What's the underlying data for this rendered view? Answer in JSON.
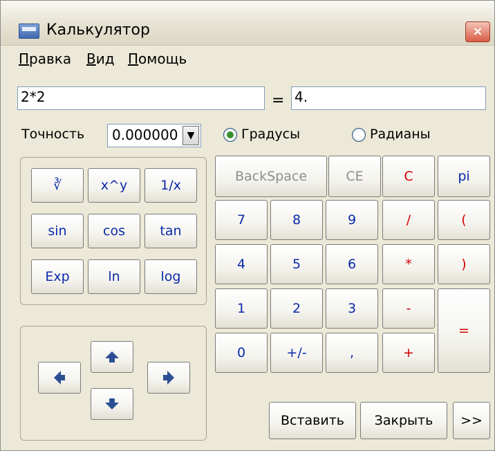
{
  "window": {
    "title": "Калькулятор",
    "close_glyph": "×"
  },
  "menu": {
    "items": [
      "Правка",
      "Вид",
      "Помощь"
    ]
  },
  "expression": {
    "value": "2*2"
  },
  "equals_sign": "=",
  "result": {
    "value": "4."
  },
  "precision": {
    "label": "Точность",
    "value": "0.000000",
    "arrow": "▼"
  },
  "angle_mode": {
    "degrees": "Градусы",
    "radians": "Радианы",
    "selected": "degrees"
  },
  "buttons": {
    "root": "∛",
    "pow": "x^y",
    "recip": "1/x",
    "sin": "sin",
    "cos": "cos",
    "tan": "tan",
    "exp": "Exp",
    "ln": "ln",
    "log": "log",
    "backspace": "BackSpace",
    "ce": "CE",
    "c": "C",
    "pi": "pi",
    "d7": "7",
    "d8": "8",
    "d9": "9",
    "div": "/",
    "lparen": "(",
    "d4": "4",
    "d5": "5",
    "d6": "6",
    "mul": "*",
    "rparen": ")",
    "d1": "1",
    "d2": "2",
    "d3": "3",
    "minus": "-",
    "equals": "=",
    "d0": "0",
    "plusminus": "+/-",
    "comma": ",",
    "plus": "+",
    "paste": "Вставить",
    "close": "Закрыть",
    "more": ">>"
  },
  "icons": {
    "app": "calculator-icon",
    "up": "arrow-up-icon",
    "down": "arrow-down-icon",
    "left": "arrow-left-icon",
    "right": "arrow-right-icon"
  },
  "colors": {
    "blue": "#0a2aa8",
    "red": "#d40000",
    "arrow": "#2c4f94"
  }
}
